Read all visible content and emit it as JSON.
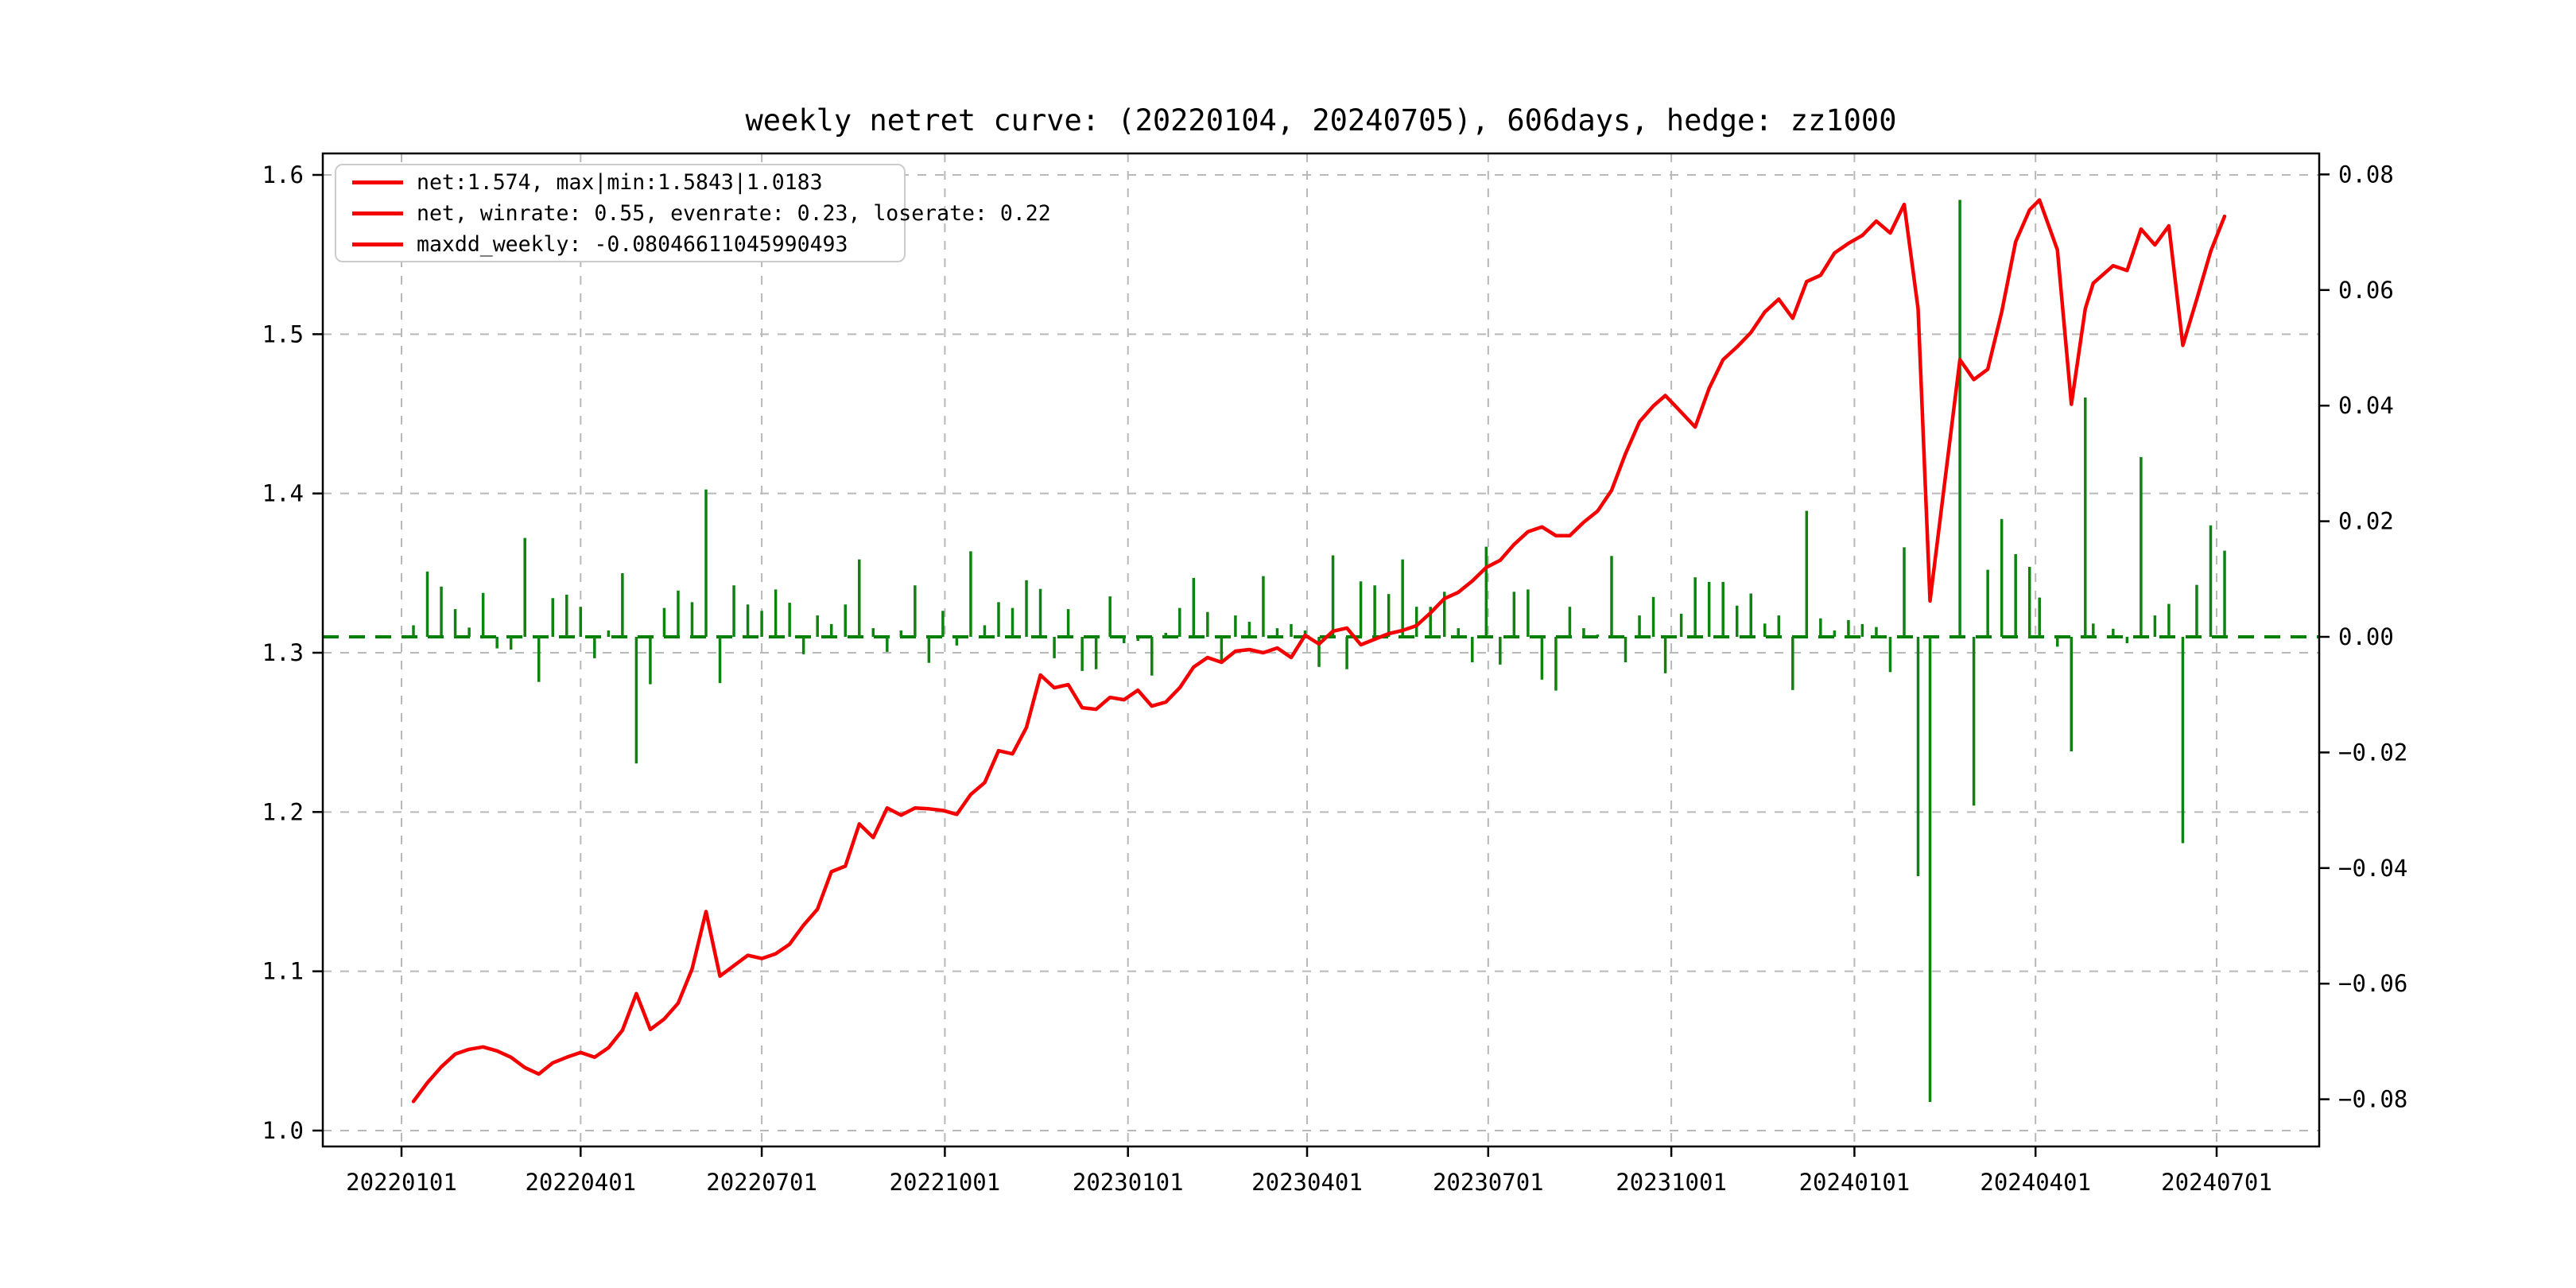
{
  "title": "weekly netret curve: (20220104, 20240705), 606days, hedge: zz1000",
  "legend": {
    "items": [
      {
        "label": "net:1.574, max|min:1.5843|1.0183",
        "swatch_color": "#f40000"
      },
      {
        "label": "net, winrate: 0.55, evenrate: 0.23, loserate: 0.22",
        "swatch_color": "#f40000"
      },
      {
        "label": "maxdd_weekly: -0.08046611045990493",
        "swatch_color": "#f40000"
      }
    ]
  },
  "colors": {
    "net_line": "#f40000",
    "ret_bar": "#0e8310",
    "zero_line": "#008000",
    "grid": "#b8b8b8",
    "frame": "#000000",
    "text": "#000000",
    "background": "#ffffff"
  },
  "chart_data": {
    "type": "line+bar",
    "title": "weekly netret curve: (20220104, 20240705), 606days, hedge: zz1000",
    "grid": "dashed, on left-axis ticks and quarterly x ticks",
    "legend_position": "upper left",
    "x_axis": {
      "tick_labels": [
        "20220101",
        "20220401",
        "20220701",
        "20221001",
        "20230101",
        "20230401",
        "20230701",
        "20231001",
        "20240101",
        "20240401",
        "20240701"
      ]
    },
    "left_y_axis": {
      "ticks": [
        "1.0",
        "1.1",
        "1.2",
        "1.3",
        "1.4",
        "1.5",
        "1.6"
      ],
      "min": 0.99,
      "max": 1.6135,
      "series": "net"
    },
    "right_y_axis": {
      "ticks": [
        "0.08",
        "0.06",
        "0.04",
        "0.02",
        "0.00",
        "-0.02",
        "-0.04",
        "-0.06",
        "-0.08"
      ],
      "min": -0.088,
      "max": 0.088,
      "series": "weekly_ret"
    },
    "zero_line": {
      "value": 0.0,
      "axis": "right",
      "style": "dashed",
      "color": "#008000"
    },
    "stats": {
      "net_final": 1.574,
      "net_max": 1.5843,
      "net_min": 1.0183,
      "winrate": 0.55,
      "evenrate": 0.23,
      "loserate": 0.22,
      "maxdd_weekly": -0.08046611045990493
    },
    "dates": [
      20220107,
      20220114,
      20220121,
      20220128,
      20220204,
      20220211,
      20220218,
      20220225,
      20220304,
      20220311,
      20220318,
      20220325,
      20220401,
      20220408,
      20220415,
      20220422,
      20220429,
      20220506,
      20220513,
      20220520,
      20220527,
      20220603,
      20220610,
      20220617,
      20220624,
      20220701,
      20220708,
      20220715,
      20220722,
      20220729,
      20220805,
      20220812,
      20220819,
      20220826,
      20220902,
      20220909,
      20220916,
      20220923,
      20220930,
      20221007,
      20221014,
      20221021,
      20221028,
      20221104,
      20221111,
      20221118,
      20221125,
      20221202,
      20221209,
      20221216,
      20221223,
      20221230,
      20230106,
      20230113,
      20230120,
      20230127,
      20230203,
      20230210,
      20230217,
      20230224,
      20230303,
      20230310,
      20230317,
      20230324,
      20230331,
      20230407,
      20230414,
      20230421,
      20230428,
      20230505,
      20230512,
      20230519,
      20230526,
      20230602,
      20230609,
      20230616,
      20230623,
      20230630,
      20230707,
      20230714,
      20230721,
      20230728,
      20230804,
      20230811,
      20230818,
      20230825,
      20230901,
      20230908,
      20230915,
      20230922,
      20230928,
      20231006,
      20231013,
      20231020,
      20231027,
      20231103,
      20231110,
      20231117,
      20231124,
      20231201,
      20231208,
      20231215,
      20231222,
      20231229,
      20240105,
      20240112,
      20240119,
      20240126,
      20240202,
      20240208,
      20240223,
      20240301,
      20240308,
      20240315,
      20240322,
      20240329,
      20240403,
      20240412,
      20240419,
      20240426,
      20240430,
      20240510,
      20240517,
      20240524,
      20240531,
      20240607,
      20240614,
      20240621,
      20240628,
      20240705
    ],
    "series": [
      {
        "name": "net",
        "type": "line",
        "axis": "left",
        "color": "#f40000",
        "values": [
          1.0183,
          1.03,
          1.04,
          1.048,
          1.051,
          1.0525,
          1.05,
          1.046,
          1.0395,
          1.0355,
          1.0425,
          1.046,
          1.049,
          1.046,
          1.052,
          1.063,
          1.086,
          1.0635,
          1.07,
          1.08,
          1.1015,
          1.1375,
          1.097,
          1.1035,
          1.11,
          1.108,
          1.111,
          1.117,
          1.129,
          1.139,
          1.1625,
          1.166,
          1.1925,
          1.184,
          1.2025,
          1.198,
          1.2025,
          1.202,
          1.201,
          1.1985,
          1.211,
          1.2185,
          1.2385,
          1.2365,
          1.253,
          1.286,
          1.278,
          1.28,
          1.2655,
          1.2645,
          1.272,
          1.2705,
          1.2765,
          1.2665,
          1.269,
          1.278,
          1.291,
          1.297,
          1.294,
          1.301,
          1.302,
          1.3,
          1.303,
          1.297,
          1.311,
          1.3055,
          1.3135,
          1.3155,
          1.305,
          1.3085,
          1.312,
          1.314,
          1.317,
          1.325,
          1.334,
          1.338,
          1.345,
          1.3535,
          1.358,
          1.368,
          1.376,
          1.379,
          1.3735,
          1.3735,
          1.382,
          1.389,
          1.402,
          1.425,
          1.445,
          1.455,
          1.4615,
          1.451,
          1.4417,
          1.466,
          1.484,
          1.492,
          1.501,
          1.514,
          1.522,
          1.51,
          1.533,
          1.537,
          1.551,
          1.557,
          1.562,
          1.571,
          1.5635,
          1.5815,
          1.516,
          1.3325,
          1.484,
          1.4715,
          1.478,
          1.514,
          1.558,
          1.578,
          1.5843,
          1.553,
          1.456,
          1.516,
          1.532,
          1.543,
          1.54,
          1.566,
          1.556,
          1.568,
          1.493,
          1.522,
          1.552,
          1.574
        ]
      },
      {
        "name": "weekly_ret",
        "type": "bar",
        "axis": "right",
        "color": "#0e8310",
        "values": [
          0.002,
          0.0113,
          0.0087,
          0.0048,
          0.0016,
          0.0076,
          -0.002,
          -0.0022,
          0.0171,
          -0.0078,
          0.0067,
          0.0073,
          0.0052,
          -0.0037,
          0.0011,
          0.011,
          -0.0219,
          -0.0082,
          0.005,
          0.008,
          0.006,
          0.0255,
          -0.008,
          0.0089,
          0.0056,
          0.0045,
          0.0082,
          0.0059,
          -0.003,
          0.0037,
          0.0022,
          0.0056,
          0.0134,
          0.0015,
          -0.0026,
          0.0011,
          0.0089,
          -0.0045,
          0.0045,
          -0.0015,
          0.0148,
          0.002,
          0.006,
          0.005,
          0.0098,
          0.0083,
          -0.0037,
          0.0048,
          -0.0059,
          -0.0056,
          0.007,
          -0.0011,
          -0.0007,
          -0.0067,
          0.0007,
          0.005,
          0.0102,
          0.0043,
          -0.0044,
          0.0037,
          0.0026,
          0.0105,
          0.0015,
          0.0022,
          0.0011,
          -0.0052,
          0.0141,
          -0.0056,
          0.0096,
          0.0089,
          0.0074,
          0.0134,
          0.0052,
          0.0052,
          0.0078,
          0.0015,
          -0.0044,
          0.0156,
          -0.0048,
          0.0078,
          0.0082,
          -0.0074,
          -0.0093,
          0.0052,
          0.0015,
          0.0004,
          0.014,
          -0.0044,
          0.0037,
          0.0069,
          -0.0063,
          0.004,
          0.0103,
          0.0095,
          0.0095,
          0.0054,
          0.0075,
          0.0023,
          0.0037,
          -0.0092,
          0.0218,
          0.0032,
          0.0011,
          0.0029,
          0.0022,
          0.0017,
          -0.0061,
          0.0155,
          -0.0414,
          -0.08046611045990493,
          0.0756,
          -0.0292,
          0.0116,
          0.0204,
          0.0143,
          0.0121,
          0.0068,
          -0.0017,
          -0.0198,
          0.0414,
          0.0023,
          0.0014,
          -0.0011,
          0.0311,
          0.0037,
          0.0057,
          -0.0357,
          0.009,
          0.0193,
          0.0149
        ]
      }
    ]
  }
}
